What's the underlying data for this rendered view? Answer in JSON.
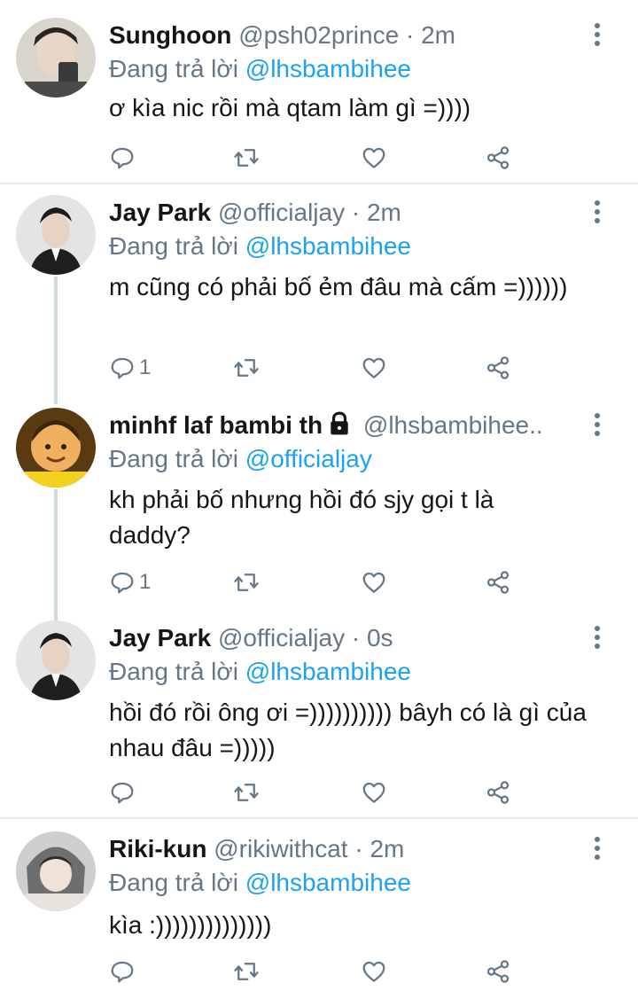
{
  "tweets": [
    {
      "name": "Sunghoon",
      "handle": "@psh02prince",
      "time": "2m",
      "reply_prefix": "Đang trả lời",
      "reply_to": "@lhsbambihee",
      "text": "ơ kìa nic rồi mà qtam làm gì =))))",
      "reply_count": "",
      "locked": false
    },
    {
      "name": "Jay Park",
      "handle": "@officialjay",
      "time": "2m",
      "reply_prefix": "Đang trả lời",
      "reply_to": "@lhsbambihee",
      "text": "m cũng có phải bố ẻm đâu mà cấm =))))))",
      "reply_count": "1",
      "locked": false
    },
    {
      "name": "minhf laf bambi th",
      "handle": "@lhsbambihee..",
      "time": "",
      "reply_prefix": "Đang trả lời",
      "reply_to": "@officialjay",
      "text": "kh phải bố nhưng hồi đó sjy gọi t là daddy?",
      "reply_count": "1",
      "locked": true
    },
    {
      "name": "Jay Park",
      "handle": "@officialjay",
      "time": "0s",
      "reply_prefix": "Đang trả lời",
      "reply_to": "@lhsbambihee",
      "text": "hồi đó rồi ông ơi =)))))))))) bâyh có là gì của nhau đâu =)))))",
      "reply_count": "",
      "locked": false
    },
    {
      "name": "Riki-kun",
      "handle": "@rikiwithcat",
      "time": "2m",
      "reply_prefix": "Đang trả lời",
      "reply_to": "@lhsbambihee",
      "text": "kìa :))))))))))))))",
      "reply_count": "",
      "locked": false
    }
  ],
  "icons": {
    "reply": "reply-icon",
    "retweet": "retweet-icon",
    "like": "like-icon",
    "share": "share-icon",
    "more": "more-vertical-icon",
    "lock": "lock-icon"
  },
  "colors": {
    "link": "#1da1f2",
    "secondary": "#657786",
    "text": "#14171a",
    "thread_line": "#cfd9de",
    "divider": "#e6ecf0"
  }
}
